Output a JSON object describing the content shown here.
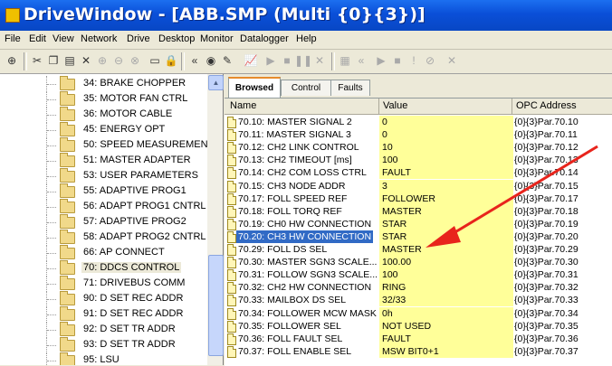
{
  "window": {
    "title": "DriveWindow - [ABB.SMP (Multi {0}{3})]"
  },
  "menu": [
    "File",
    "Edit",
    "View",
    "Network",
    "Drive",
    "Desktop",
    "Monitor",
    "Datalogger",
    "Help"
  ],
  "tree": {
    "items": [
      "34: BRAKE CHOPPER",
      "35: MOTOR FAN CTRL",
      "36: MOTOR CABLE",
      "45: ENERGY OPT",
      "50: SPEED MEASUREMEN",
      "51: MASTER ADAPTER",
      "53: USER PARAMETERS",
      "55: ADAPTIVE PROG1",
      "56: ADAPT PROG1 CNTRL",
      "57: ADAPTIVE PROG2",
      "58: ADAPT PROG2 CNTRL",
      "66: AP CONNECT",
      "70: DDCS CONTROL",
      "71: DRIVEBUS COMM",
      "90: D SET REC ADDR",
      "91: D SET REC ADDR",
      "92: D SET TR ADDR",
      "93: D SET TR ADDR",
      "95: LSU"
    ],
    "selected_index": 12
  },
  "tabs": [
    "Browsed",
    "Control",
    "Faults"
  ],
  "grid": {
    "headers": [
      "Name",
      "Value",
      "OPC Address"
    ],
    "rows": [
      [
        "70.10: MASTER SIGNAL 2",
        "0",
        "{0}{3}Par.70.10"
      ],
      [
        "70.11: MASTER SIGNAL 3",
        "0",
        "{0}{3}Par.70.11"
      ],
      [
        "70.12: CH2 LINK CONTROL",
        "10",
        "{0}{3}Par.70.12"
      ],
      [
        "70.13: CH2 TIMEOUT [ms]",
        "100",
        "{0}{3}Par.70.13"
      ],
      [
        "70.14: CH2 COM LOSS CTRL",
        "FAULT",
        "{0}{3}Par.70.14"
      ],
      [
        "70.15: CH3 NODE ADDR",
        "3",
        "{0}{3}Par.70.15"
      ],
      [
        "70.17: FOLL SPEED REF",
        "FOLLOWER",
        "{0}{3}Par.70.17"
      ],
      [
        "70.18: FOLL TORQ REF",
        "MASTER",
        "{0}{3}Par.70.18"
      ],
      [
        "70.19: CH0 HW CONNECTION",
        "STAR",
        "{0}{3}Par.70.19"
      ],
      [
        "70.20: CH3 HW CONNECTION",
        "STAR",
        "{0}{3}Par.70.20"
      ],
      [
        "70.29: FOLL DS SEL",
        "MASTER",
        "{0}{3}Par.70.29"
      ],
      [
        "70.30: MASTER SGN3 SCALE...",
        "100.00",
        "{0}{3}Par.70.30"
      ],
      [
        "70.31: FOLLOW SGN3 SCALE...",
        "100",
        "{0}{3}Par.70.31"
      ],
      [
        "70.32: CH2 HW CONNECTION",
        "RING",
        "{0}{3}Par.70.32"
      ],
      [
        "70.33: MAILBOX DS SEL",
        "32/33",
        "{0}{3}Par.70.33"
      ],
      [
        "70.34: FOLLOWER MCW MASK",
        "0h",
        "{0}{3}Par.70.34"
      ],
      [
        "70.35: FOLLOWER SEL",
        "NOT USED",
        "{0}{3}Par.70.35"
      ],
      [
        "70.36: FOLL FAULT SEL",
        "FAULT",
        "{0}{3}Par.70.36"
      ],
      [
        "70.37: FOLL ENABLE SEL",
        "MSW BIT0+1",
        "{0}{3}Par.70.37"
      ]
    ],
    "selected_index": 9
  },
  "annotation": {
    "arrow_color": "#e8241c"
  },
  "colors": {
    "title_bar": "#0a4fd8",
    "value_cell": "#ffff99",
    "selection": "#316ac5"
  }
}
